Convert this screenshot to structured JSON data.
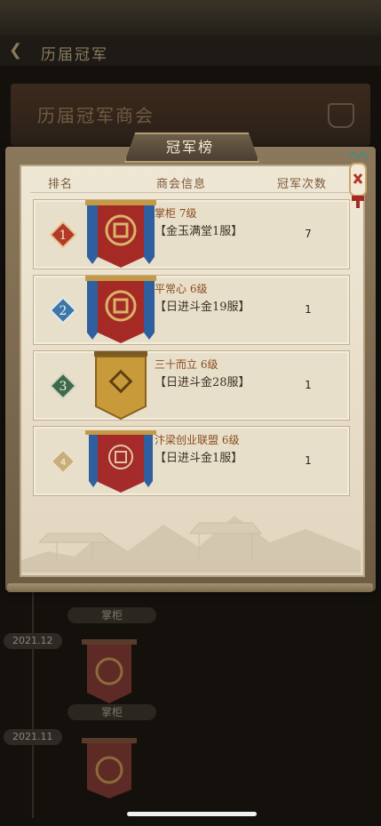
{
  "background": {
    "nav_title": "历届冠军",
    "header_title": "历届冠军商会",
    "header_side": "冠军",
    "entries": [
      {
        "date": "2021.12",
        "caption": "掌柜"
      },
      {
        "date": "2021.11",
        "caption": "掌柜"
      }
    ],
    "top_caption": "掌柜"
  },
  "modal": {
    "title": "冠军榜",
    "columns": {
      "rank": "排名",
      "info": "商会信息",
      "count": "冠军次数"
    },
    "rows": [
      {
        "rank": "1",
        "guild": "掌柜 7级",
        "server": "【金玉满堂1服】",
        "count": "7",
        "badge_color": "#b23a2a",
        "banner": "red-blue"
      },
      {
        "rank": "2",
        "guild": "平常心 6级",
        "server": "【日进斗金19服】",
        "count": "1",
        "badge_color": "#3d77a6",
        "banner": "red-blue"
      },
      {
        "rank": "3",
        "guild": "三十而立 6级",
        "server": "【日进斗金28服】",
        "count": "1",
        "badge_color": "#3f6a4a",
        "banner": "gold"
      },
      {
        "rank": "4",
        "guild": "汴梁创业联盟 6级",
        "server": "【日进斗金1服】",
        "count": "1",
        "badge_color": "#c9ae7c",
        "banner": "red-blue-small"
      }
    ]
  },
  "colors": {
    "accent": "#8a4b1d",
    "paper": "#e8dfcb",
    "frame": "#7c6a4f"
  }
}
